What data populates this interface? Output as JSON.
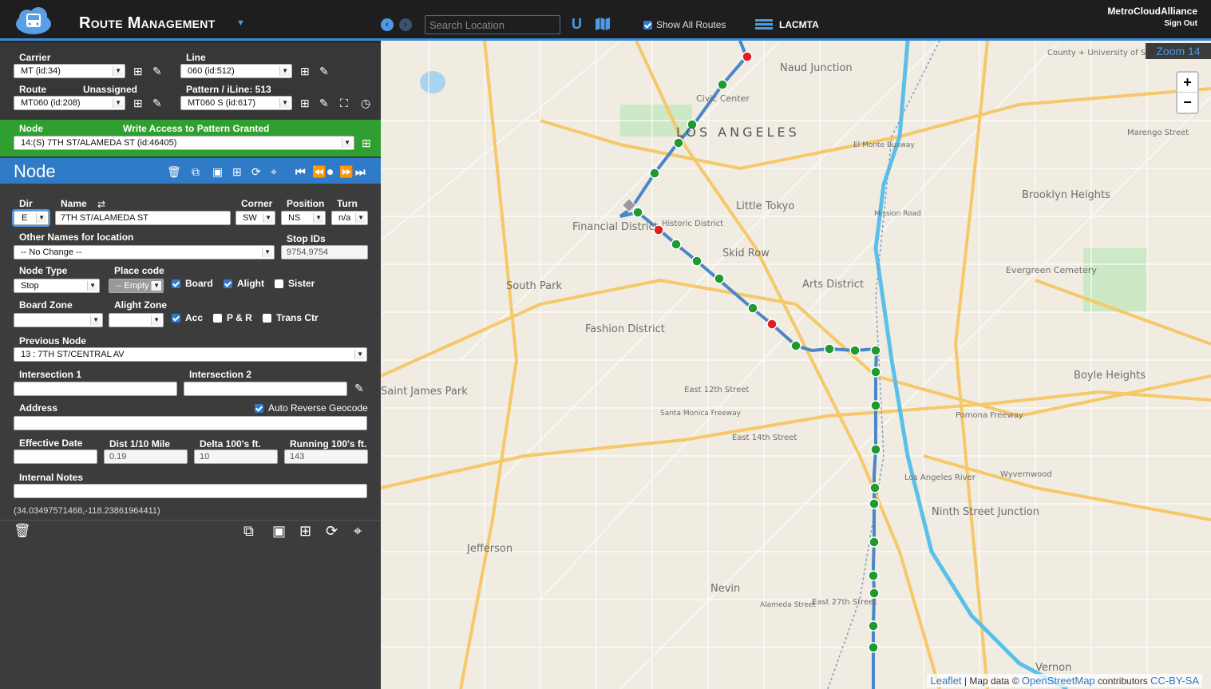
{
  "header": {
    "title": "Route Management",
    "org": "MetroCloudAlliance",
    "sign_out": "Sign Out",
    "search_placeholder": "Search Location",
    "show_all_routes": "Show All Routes",
    "agency": "LACMTA"
  },
  "selectors": {
    "carrier_label": "Carrier",
    "carrier_value": "MT (id:34)",
    "line_label": "Line",
    "line_value": "060 (id:512)",
    "route_label": "Route",
    "route_status": "Unassigned",
    "route_value": "MT060 (id:208)",
    "pattern_label": "Pattern / iLine: 513",
    "pattern_value": "MT060 S (id:617)",
    "node_label": "Node",
    "write_access": "Write Access to Pattern Granted",
    "node_value": "14:(S) 7TH ST/ALAMEDA ST (id:46405)"
  },
  "node_panel": {
    "title": "Node",
    "dir_label": "Dir",
    "dir_value": "E",
    "name_label": "Name",
    "name_value": "7TH ST/ALAMEDA ST",
    "corner_label": "Corner",
    "corner_value": "SW",
    "position_label": "Position",
    "position_value": "NS",
    "turn_label": "Turn",
    "turn_value": "n/a",
    "other_names_label": "Other Names for location",
    "other_names_value": "-- No Change --",
    "stop_ids_label": "Stop IDs",
    "stop_ids_value": "9754,9754",
    "node_type_label": "Node Type",
    "node_type_value": "Stop",
    "place_code_label": "Place code",
    "place_code_value": "-- Empty --",
    "board_label": "Board",
    "alight_label": "Alight",
    "sister_label": "Sister",
    "board_zone_label": "Board Zone",
    "alight_zone_label": "Alight Zone",
    "acc_label": "Acc",
    "pr_label": "P & R",
    "trans_ctr_label": "Trans Ctr",
    "previous_node_label": "Previous Node",
    "previous_node_value": "13 : 7TH ST/CENTRAL AV",
    "intersection1_label": "Intersection 1",
    "intersection2_label": "Intersection 2",
    "address_label": "Address",
    "auto_reverse_label": "Auto Reverse Geocode",
    "effective_date_label": "Effective Date",
    "dist_label": "Dist 1/10 Mile",
    "dist_value": "0.19",
    "delta_label": "Delta 100's ft.",
    "delta_value": "10",
    "running_label": "Running 100's ft.",
    "running_value": "143",
    "internal_notes_label": "Internal Notes",
    "coords": "(34.03497571468,-118.23861964411)"
  },
  "map": {
    "zoom": "Zoom 14",
    "attrib_leaflet": "Leaflet",
    "attrib_text": "| Map data ©",
    "attrib_osm": "OpenStreetMap",
    "attrib_contrib": "contributors",
    "attrib_license": "CC-BY-SA",
    "route_color": "#4a86c8",
    "stop_color": "#1e9a2e",
    "timepoint_color": "#e02020",
    "labels": [
      "Naud Junction",
      "LOS ANGELES",
      "Civic Center",
      "Financial District",
      "Little Tokyo",
      "Historic District",
      "Skid Row",
      "Arts District",
      "South Park",
      "Fashion District",
      "Saint James Park",
      "Jefferson",
      "Nevin",
      "Vernon",
      "Boyle Heights",
      "Brooklyn Heights",
      "Evergreen Cemetery",
      "Pomona Freeway",
      "Wyvernwood",
      "Ninth Street Junction",
      "Los Angeles River",
      "El Monte Busway",
      "Santa Monica Freeway",
      "East 14th Street",
      "East 12th Street",
      "Mission Road",
      "Alameda Street",
      "East 27th Street",
      "Marengo Street",
      "County + University of Southern California Medical Center"
    ]
  }
}
